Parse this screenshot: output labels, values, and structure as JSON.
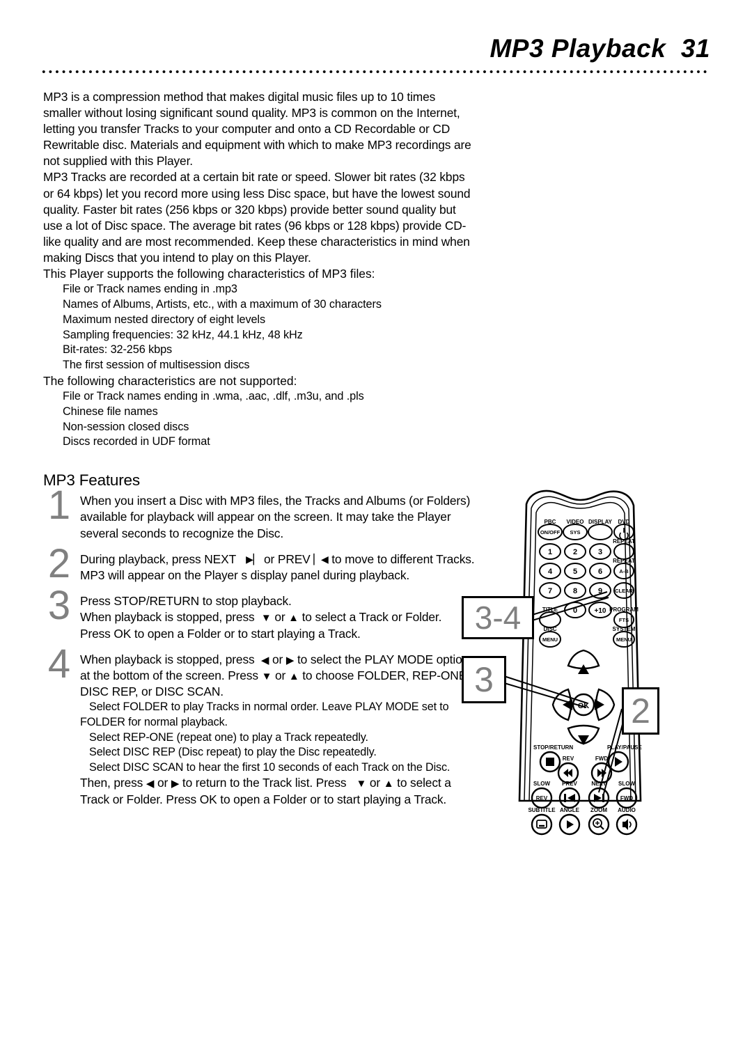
{
  "header": {
    "title": "MP3 Playback  31"
  },
  "body": {
    "paragraph1": "MP3 is a compression method that makes digital music files up to 10 times smaller without losing significant sound quality. MP3 is common on the Internet, letting you transfer Tracks to your computer and onto a CD Recordable or CD Rewritable disc. Materials and equipment with which to make MP3 recordings are not supplied with this Player.",
    "paragraph2": "MP3 Tracks are recorded at a certain bit rate or speed. Slower bit rates (32 kbps or 64 kbps) let you record more using less Disc space, but have the lowest sound quality. Faster bit rates (256 kbps or 320 kbps) provide better sound quality but use a lot of Disc space. The average bit rates (96 kbps or 128 kbps) provide CD-like quality and are most recommended. Keep these characteristics in mind when making Discs that you intend to play on this Player.",
    "supported_intro": "This Player supports the following characteristics of MP3 files:",
    "supported_items": [
      "File or Track names ending in .mp3",
      "Names of Albums, Artists, etc., with a maximum of 30 characters",
      "Maximum nested directory of eight levels",
      "Sampling frequencies: 32 kHz, 44.1 kHz, 48 kHz",
      "Bit-rates: 32-256 kbps",
      "The first session of multisession discs"
    ],
    "unsupported_intro": "The following characteristics are not supported:",
    "unsupported_items": [
      "File or Track names ending in .wma, .aac, .dlf, .m3u, and .pls",
      "Chinese file names",
      "Non-session closed discs",
      "Discs recorded in UDF format"
    ]
  },
  "features": {
    "heading": "MP3 Features",
    "steps": [
      {
        "number": "1",
        "text": "When you insert a Disc with MP3 files, the Tracks and Albums (or Folders) available for playback will appear on the screen.  It may take the Player several seconds to recognize the Disc."
      },
      {
        "number": "2",
        "text_a": "During playback, press NEXT",
        "symbol_next": "▶▏",
        "text_b": "or PREV",
        "symbol_prev": "▏◀",
        "text_c": "to move to different Tracks.   MP3 will appear on the Player s display panel during playback."
      },
      {
        "number": "3",
        "line1": "Press STOP/RETURN      to stop playback.",
        "line2_a": "When playback is stopped, press",
        "sym_down": "▼",
        "line2_b": "or",
        "sym_up": "▲",
        "line2_c": "to select a Track or Folder. Press OK to open a Folder or to start playing a Track."
      },
      {
        "number": "4",
        "line1_a": "When playback is stopped, press",
        "sym_left": "◀",
        "line1_b": "or",
        "sym_right": "▶",
        "line1_c": "to select the PLAY MODE options at the bottom of the screen. Press",
        "sym_down": "▼",
        "line1_d": "or",
        "sym_up": "▲",
        "line1_e": "to choose FOLDER, REP-ONE, DISC REP, or DISC SCAN.",
        "detail1": "Select FOLDER to play Tracks in normal order. Leave PLAY MODE set to FOLDER for normal playback.",
        "detail2": "Select REP-ONE (repeat one) to play a Track repeatedly.",
        "detail3": "Select DISC REP (Disc repeat) to play the Disc repeatedly.",
        "detail4": "Select DISC SCAN to hear the first 10 seconds of each Track on the Disc.",
        "detail5_a": "Then, press",
        "detail5_sym_left": "◀",
        "detail5_b": "or",
        "detail5_sym_right": "▶",
        "detail5_c": "to return to the Track list. Press",
        "detail5_sym_down": "▼",
        "detail5_d": "or",
        "detail5_sym_up": "▲",
        "detail5_e": "to select a Track or Folder. Press OK to open a Folder or to start playing a Track."
      }
    ]
  },
  "remote": {
    "callouts": [
      {
        "label": "3-4"
      },
      {
        "label": "3"
      },
      {
        "label": "2"
      }
    ],
    "buttons": {
      "pbc_label": "PBC",
      "pbc": "ON/OFF",
      "video_label": "VIDEO",
      "video": "SYS",
      "display_label": "DISPLAY",
      "dvd_label": "DVD",
      "dvd": "⏻",
      "repeat_label": "REPEAT",
      "repeat_ab_label": "REPEAT",
      "repeat_ab": "A-B",
      "num1": "1",
      "num2": "2",
      "num3": "3",
      "num4": "4",
      "num5": "5",
      "num6": "6",
      "num7": "7",
      "num8": "8",
      "num9": "9",
      "num0": "0",
      "plus10": "+10",
      "clear": "CLEAR",
      "title_label": "TITLE",
      "program_label": "PROGRAM",
      "fts": "FTS",
      "disc_label": "DISC",
      "menu_disc": "MENU",
      "system_label": "SYSTEM",
      "menu_system": "MENU",
      "ok": "OK",
      "stop_label": "STOP/RETURN",
      "play_label": "PLAY/PAUSE",
      "rev_label": "REV",
      "fwd_label": "FWD",
      "slow_rev_label": "SLOW",
      "slow_rev": "REV",
      "prev_label": "PREV",
      "next_label": "NEXT",
      "slow_fwd_label": "SLOW",
      "slow_fwd": "FWD",
      "subtitle_label": "SUBTITLE",
      "angle_label": "ANGLE",
      "zoom_label": "ZOOM",
      "audio_label": "AUDIO"
    }
  }
}
